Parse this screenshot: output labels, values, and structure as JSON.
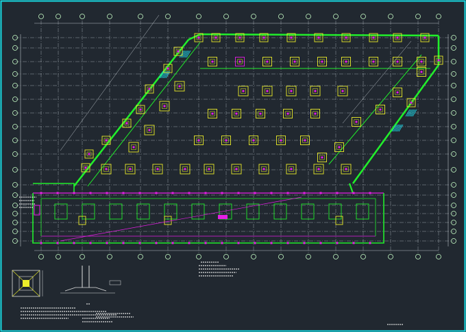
{
  "drawing": {
    "background": "#212830",
    "border_color": "#19d8e0",
    "colors": {
      "grid": "#b9c0c7",
      "axis_bubble": "#c8ffc8",
      "wall": "#21ee2b",
      "footing": "#eced2a",
      "column": "#e61ee6",
      "hatch": "#1ed6e6",
      "text": "#e0e0e0"
    },
    "layers": [
      "axis-grid",
      "footings",
      "walls-beams",
      "columns",
      "annotations"
    ],
    "title_block_label": "",
    "notes_label": ""
  }
}
